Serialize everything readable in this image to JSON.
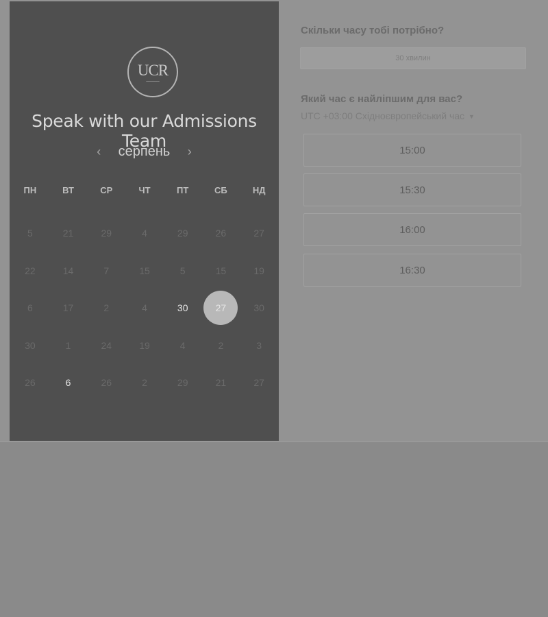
{
  "branding": {
    "logo_text": "UCR",
    "title": "Speak with our Admissions Team"
  },
  "calendar": {
    "month": "серпень",
    "prev_icon": "chevron-left-icon",
    "next_icon": "chevron-right-icon",
    "prev_glyph": "‹",
    "next_glyph": "›",
    "weekdays": [
      "ПН",
      "ВТ",
      "СР",
      "ЧТ",
      "ПТ",
      "СБ",
      "НД"
    ],
    "weeks": [
      [
        {
          "day": "5",
          "state": "disabled"
        },
        {
          "day": "21",
          "state": "disabled"
        },
        {
          "day": "29",
          "state": "disabled"
        },
        {
          "day": "4",
          "state": "disabled"
        },
        {
          "day": "29",
          "state": "disabled"
        },
        {
          "day": "26",
          "state": "disabled"
        },
        {
          "day": "27",
          "state": "disabled"
        }
      ],
      [
        {
          "day": "22",
          "state": "disabled"
        },
        {
          "day": "14",
          "state": "disabled"
        },
        {
          "day": "7",
          "state": "disabled"
        },
        {
          "day": "15",
          "state": "disabled"
        },
        {
          "day": "5",
          "state": "disabled"
        },
        {
          "day": "15",
          "state": "disabled"
        },
        {
          "day": "19",
          "state": "disabled"
        }
      ],
      [
        {
          "day": "6",
          "state": "disabled"
        },
        {
          "day": "17",
          "state": "disabled"
        },
        {
          "day": "2",
          "state": "disabled"
        },
        {
          "day": "4",
          "state": "disabled"
        },
        {
          "day": "30",
          "state": "available"
        },
        {
          "day": "27",
          "state": "selected"
        },
        {
          "day": "30",
          "state": "disabled"
        }
      ],
      [
        {
          "day": "30",
          "state": "disabled"
        },
        {
          "day": "1",
          "state": "disabled"
        },
        {
          "day": "24",
          "state": "disabled"
        },
        {
          "day": "19",
          "state": "disabled"
        },
        {
          "day": "4",
          "state": "disabled"
        },
        {
          "day": "2",
          "state": "disabled"
        },
        {
          "day": "3",
          "state": "disabled"
        }
      ],
      [
        {
          "day": "26",
          "state": "disabled"
        },
        {
          "day": "6",
          "state": "available"
        },
        {
          "day": "26",
          "state": "disabled"
        },
        {
          "day": "2",
          "state": "disabled"
        },
        {
          "day": "29",
          "state": "disabled"
        },
        {
          "day": "21",
          "state": "disabled"
        },
        {
          "day": "27",
          "state": "disabled"
        }
      ]
    ]
  },
  "booking": {
    "duration_question": "Скільки часу тобі потрібно?",
    "duration_value": "30 хвилин",
    "time_question": "Який час є найліпшим для вас?",
    "timezone": "UTC +03:00 Східноєвропейський час",
    "timezone_caret": "▼",
    "slots": [
      "15:00",
      "15:30",
      "16:00",
      "16:30"
    ]
  },
  "colors": {
    "overlay": "#8a8a8a",
    "panel": "#4f4f4f",
    "selected_day": "#b8b8b8"
  }
}
